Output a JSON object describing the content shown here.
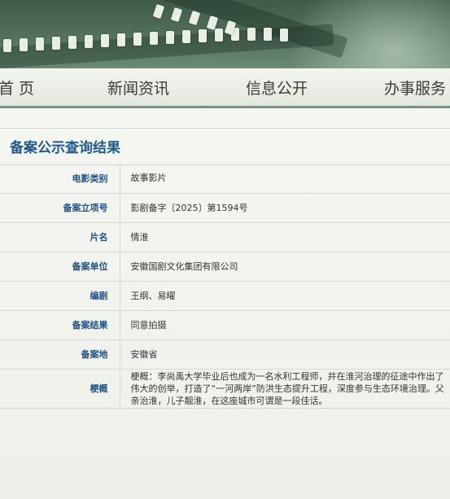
{
  "nav": {
    "items": [
      {
        "label": "首 页"
      },
      {
        "label": "新闻资讯"
      },
      {
        "label": "信息公开"
      },
      {
        "label": "办事服务"
      }
    ]
  },
  "page": {
    "title": "备案公示查询结果"
  },
  "record": {
    "fields": [
      {
        "label": "电影类别",
        "value": "故事影片"
      },
      {
        "label": "备案立项号",
        "value": "影剧备字〔2025〕第1594号"
      },
      {
        "label": "片名",
        "value": "情淮"
      },
      {
        "label": "备案单位",
        "value": "安徽国剧文化集团有限公司"
      },
      {
        "label": "编剧",
        "value": "王纲、易曜"
      },
      {
        "label": "备案结果",
        "value": "同意拍摄"
      },
      {
        "label": "备案地",
        "value": "安徽省"
      },
      {
        "label": "梗概",
        "value": "梗概：李尚禹大学毕业后也成为一名水利工程师，并在淮河治理的征途中作出了伟大的创举，打造了“一河两岸”防洪生态提升工程，深度参与生态环境治理。父亲治淮，儿子靓淮，在这座城市可谓是一段佳话。"
      }
    ]
  },
  "colors": {
    "title": "#1f5a8f",
    "label": "#1f4f86",
    "nav_border": "#7c8f80",
    "banner": "#4f6d5a"
  },
  "icons": [
    "film-strip-decoration"
  ]
}
